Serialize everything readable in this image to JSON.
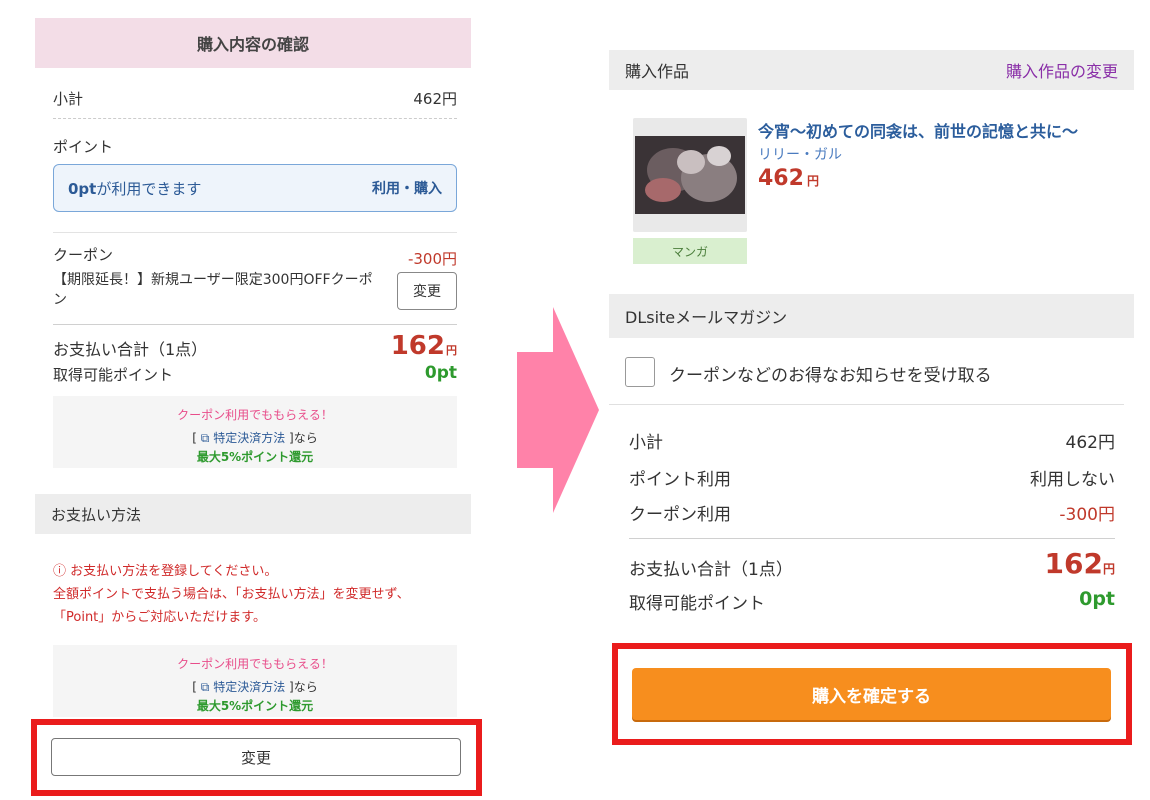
{
  "left": {
    "header": "購入内容の確認",
    "subtotal_label": "小計",
    "subtotal_value": "462円",
    "point_label": "ポイント",
    "point_box": {
      "amount": "0pt",
      "msg": "が利用できます",
      "action": "利用・購入"
    },
    "coupon": {
      "label": "クーポン",
      "amount": "-300円",
      "name": "【期限延長！】新規ユーザー限定300円OFFクーポン",
      "change": "変更"
    },
    "total": {
      "label": "お支払い合計（1点）",
      "value": "162",
      "yen": "円"
    },
    "earn": {
      "label": "取得可能ポイント",
      "value": "0pt"
    },
    "promo": {
      "line1": "クーポン利用でももらえる！",
      "bracket_open": "[",
      "link": "特定決済方法",
      "bracket_close": "]なら",
      "line3": "最大5%ポイント還元"
    },
    "payment_header": "お支払い方法",
    "warning": {
      "line1": "お支払い方法を登録してください。",
      "line2": "全額ポイントで支払う場合は、「お支払い方法」を変更せず、「Point」からご対応いただけます。"
    },
    "change_button": "変更"
  },
  "right": {
    "works_header": "購入作品",
    "works_change": "購入作品の変更",
    "work": {
      "title": "今宵〜初めての同衾は、前世の記憶と共に〜",
      "author": "リリー・ガル",
      "price": "462",
      "yen": "円",
      "genre": "マンガ"
    },
    "mail_header": "DLsiteメールマガジン",
    "mail_checkbox": "クーポンなどのお得なお知らせを受け取る",
    "rows": [
      {
        "label": "小計",
        "value": "462円"
      },
      {
        "label": "ポイント利用",
        "value": "利用しない"
      },
      {
        "label": "クーポン利用",
        "value": "-300円"
      }
    ],
    "total": {
      "label": "お支払い合計（1点）",
      "value": "162",
      "yen": "円"
    },
    "earn": {
      "label": "取得可能ポイント",
      "value": "0pt"
    },
    "confirm_button": "購入を確定する"
  },
  "colors": {
    "header_pink": "#f3dde7",
    "price_red": "#c0392b",
    "point_green": "#2e9a2e",
    "confirm_orange": "#f78e1e",
    "highlight_red": "#ea1c1c",
    "arrow_pink": "#ff82a9"
  }
}
